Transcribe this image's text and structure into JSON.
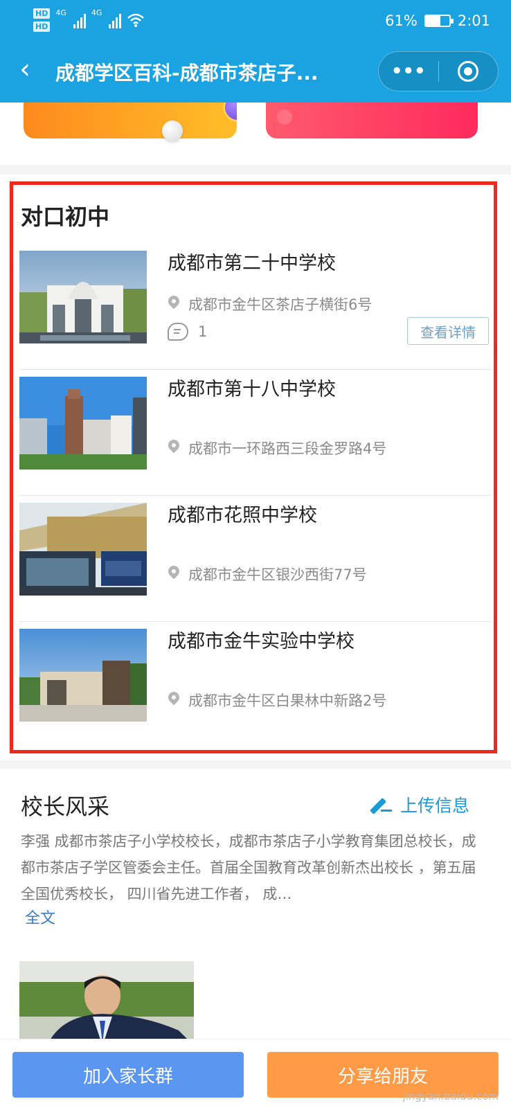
{
  "status_bar": {
    "hd1": "HD",
    "hd2": "HD",
    "net1": "4G",
    "net2": "4G",
    "battery": "61%",
    "battery_level": 0.61,
    "time": "2:01"
  },
  "navbar": {
    "back_icon": "chevron-left-icon",
    "title": "成都学区百科-成都市茶店子...",
    "more_icon": "more-dots-icon",
    "target_icon": "target-icon"
  },
  "middle_schools": {
    "title": "对口初中",
    "items": [
      {
        "name": "成都市第二十中学校",
        "address": "成都市金牛区茶店子横街6号",
        "comments": "1",
        "detail_label": "查看详情"
      },
      {
        "name": "成都市第十八中学校",
        "address": "成都市一环路西三段金罗路4号"
      },
      {
        "name": "成都市花照中学校",
        "address": "成都市金牛区银沙西街77号"
      },
      {
        "name": "成都市金牛实验中学校",
        "address": "成都市金牛区白果林中新路2号"
      }
    ]
  },
  "principal": {
    "title": "校长风采",
    "upload_label": "上传信息",
    "text": "李强 成都市茶店子小学校校长，成都市茶店子小学教育集团总校长，成都市茶店子学区管委会主任。首届全国教育改革创新杰出校长 ，第五届全国优秀校长， 四川省先进工作者， 成…",
    "fulltext_label": "全文"
  },
  "bottom": {
    "join_label": "加入家长群",
    "share_label": "分享给朋友",
    "watermark": "jingyan.baidu.com"
  },
  "colors": {
    "header": "#1aa3e0",
    "highlight_box": "#ec2a1e",
    "join_button": "#5b96f0",
    "share_button": "#ff9a46",
    "link": "#1a9ad6"
  }
}
